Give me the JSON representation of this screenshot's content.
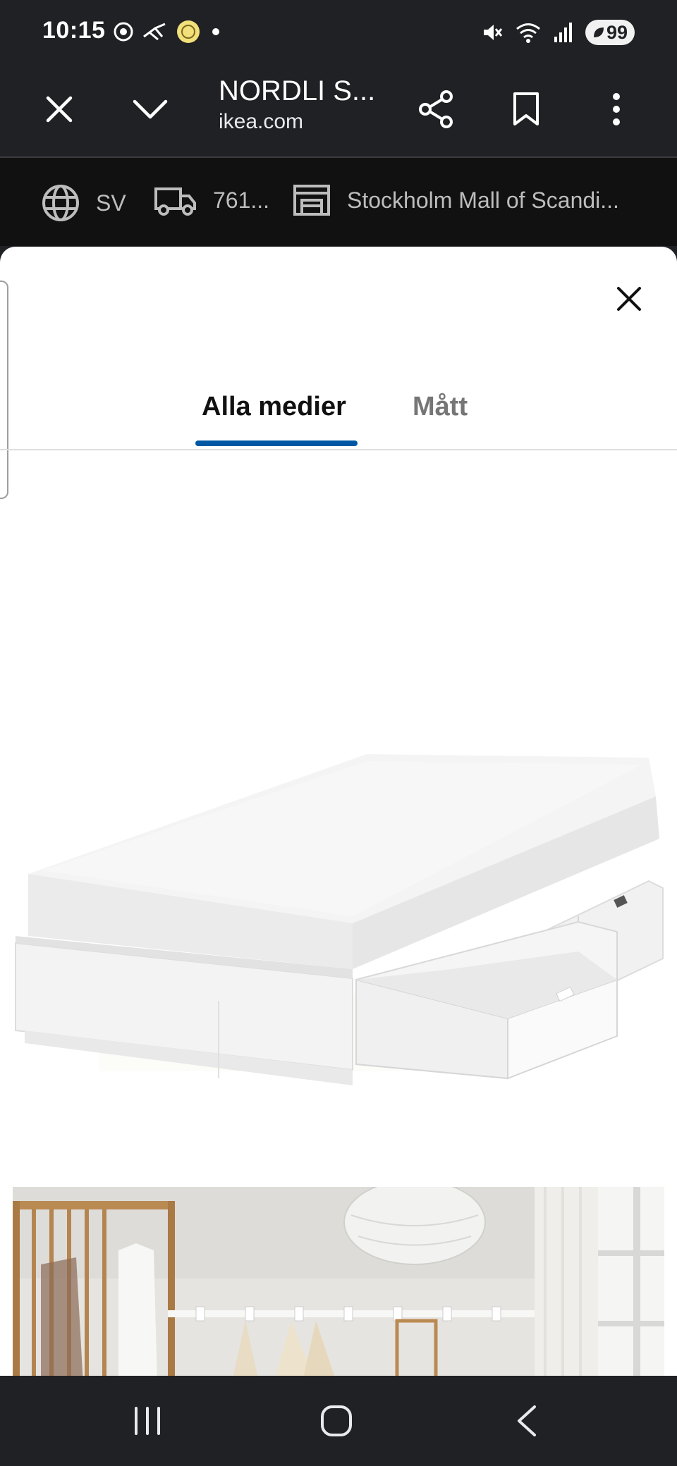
{
  "status_bar": {
    "time": "10:15",
    "battery": "99",
    "left_icons": [
      "chrome-icon",
      "messaging-icon",
      "notification-app-icon",
      "dot-icon"
    ],
    "right_icons": [
      "mute-icon",
      "wifi-icon",
      "signal-icon",
      "battery-saver-icon"
    ]
  },
  "browser_header": {
    "title": "NORDLI S...",
    "url": "ikea.com",
    "icons": [
      "close-icon",
      "chevron-down-icon",
      "share-icon",
      "bookmark-icon",
      "more-vert-icon"
    ]
  },
  "locale_bar": {
    "language": "SV",
    "postcode": "761...",
    "store": "Stockholm Mall of Scandi..."
  },
  "media_sheet": {
    "tabs": [
      {
        "label": "Alla medier",
        "active": true
      },
      {
        "label": "Mått",
        "active": false
      }
    ],
    "accent_color": "#0058a3"
  },
  "nav_bar": {
    "icons": [
      "recent-apps-icon",
      "home-icon",
      "back-icon"
    ]
  }
}
